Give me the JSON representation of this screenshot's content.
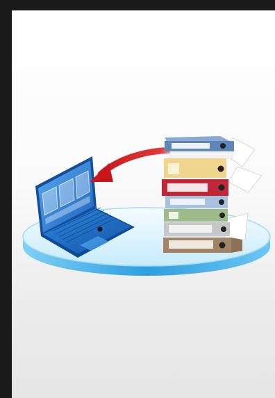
{
  "scene": {
    "description_icon": "laptop-and-binders-data-migration",
    "colors": {
      "frame": "#1a1a1a",
      "platform_top": "#cdeefd",
      "platform_side": "#3aa8e0",
      "laptop_body": "#1f6fc4",
      "laptop_screen": "#3e8fe0",
      "arrow": "#d42020"
    },
    "binders": [
      {
        "name": "binder-blue",
        "color": "#5f86b8"
      },
      {
        "name": "binder-beige",
        "color": "#efd58e"
      },
      {
        "name": "binder-red",
        "color": "#c0283a"
      },
      {
        "name": "binder-lightblue",
        "color": "#a7c3de"
      },
      {
        "name": "binder-green",
        "color": "#9dbb88"
      },
      {
        "name": "binder-gray",
        "color": "#c7c7c7"
      },
      {
        "name": "binder-brown",
        "color": "#a08466"
      }
    ]
  }
}
